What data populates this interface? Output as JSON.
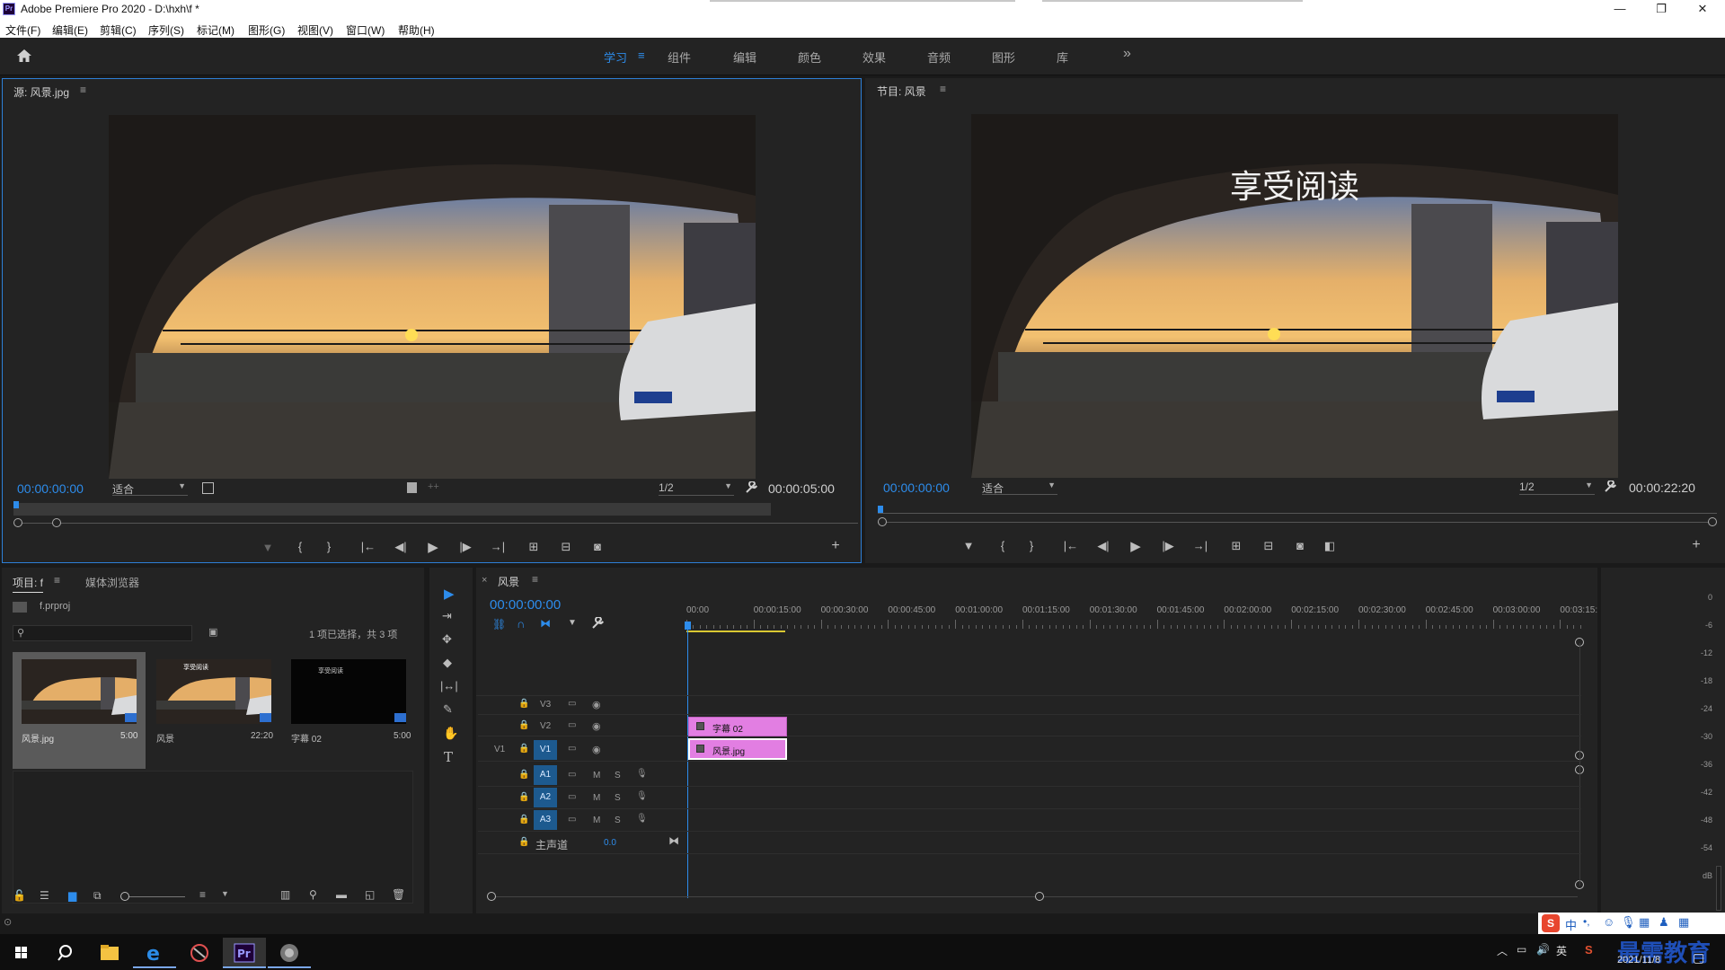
{
  "window": {
    "title": "Adobe Premiere Pro 2020 - D:\\hxh\\f *",
    "logo": "Pr",
    "minimize_icon": "—",
    "maximize_icon": "❐",
    "close_icon": "✕"
  },
  "menu": [
    "文件(F)",
    "编辑(E)",
    "剪辑(C)",
    "序列(S)",
    "标记(M)",
    "图形(G)",
    "视图(V)",
    "窗口(W)",
    "帮助(H)"
  ],
  "workspaces": {
    "items": [
      "学习",
      "组件",
      "编辑",
      "颜色",
      "效果",
      "音频",
      "图形",
      "库"
    ],
    "active": "学习",
    "more": "»"
  },
  "source_monitor": {
    "title": "源: 风景.jpg",
    "timecode_in": "00:00:00:00",
    "zoom": "适合",
    "resolution": "1/2",
    "duration": "00:00:05:00"
  },
  "program_monitor": {
    "title": "节目: 风景",
    "overlay_text": "享受阅读",
    "timecode_in": "00:00:00:00",
    "zoom": "适合",
    "resolution": "1/2",
    "duration": "00:00:22:20"
  },
  "project": {
    "tab_active": "项目: f",
    "tab_other": "媒体浏览器",
    "file": "f.prproj",
    "selection_info": "1 项已选择，共 3 项",
    "items": [
      {
        "name": "风景.jpg",
        "duration": "5:00"
      },
      {
        "name": "风景",
        "duration": "22:20"
      },
      {
        "name": "字幕 02",
        "duration": "5:00"
      }
    ],
    "thumb_caption": "享受阅读"
  },
  "timeline": {
    "tab": "风景",
    "close": "×",
    "timecode": "00:00:00:00",
    "ruler": [
      "00:00",
      "00:00:15:00",
      "00:00:30:00",
      "00:00:45:00",
      "00:01:00:00",
      "00:01:15:00",
      "00:01:30:00",
      "00:01:45:00",
      "00:02:00:00",
      "00:02:15:00",
      "00:02:30:00",
      "00:02:45:00",
      "00:03:00:00",
      "00:03:15:"
    ],
    "video_tracks": [
      "V3",
      "V2",
      "V1"
    ],
    "source_patch": "V1",
    "audio_tracks": [
      "A1",
      "A2",
      "A3"
    ],
    "audio_m": "M",
    "audio_s": "S",
    "master_label": "主声道",
    "master_value": "0.0",
    "clips": [
      {
        "name": "字幕 02",
        "track": "V2"
      },
      {
        "name": "风景.jpg",
        "track": "V1"
      }
    ]
  },
  "audio_meter": {
    "scale": [
      "0",
      "-6",
      "-12",
      "-18",
      "-24",
      "-30",
      "-36",
      "-42",
      "-48",
      "-54",
      "dB"
    ]
  },
  "taskbar": {
    "date": "2021/11/8",
    "ime": "中",
    "watermark": "最需教育"
  },
  "colors": {
    "accent": "#2d8ceb",
    "clip": "#e27ee2",
    "track_target": "#1d5a8f",
    "playhead": "#2d8ceb"
  }
}
